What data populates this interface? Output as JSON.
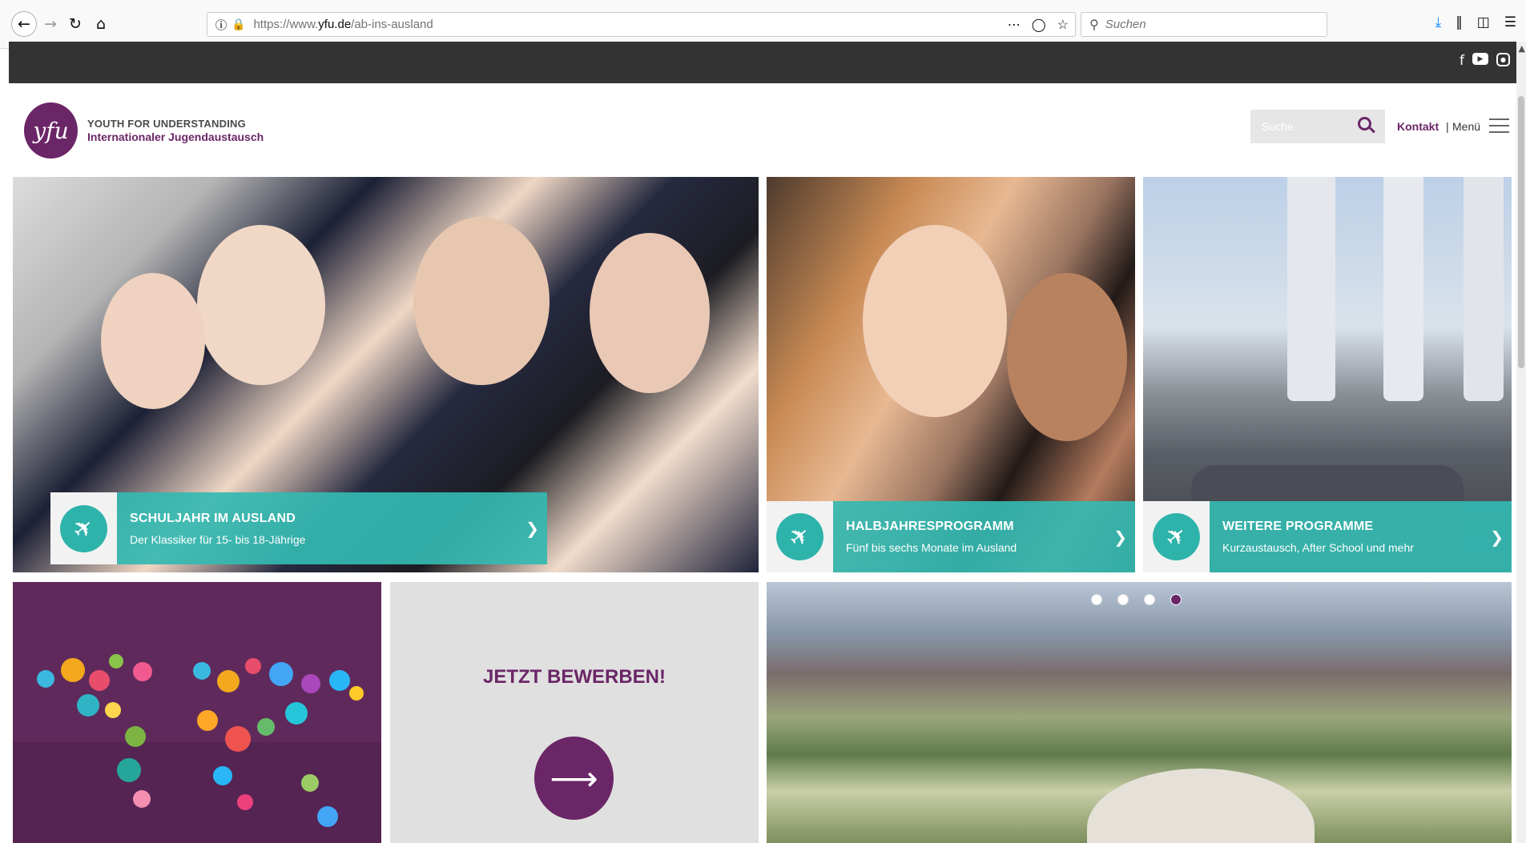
{
  "browser": {
    "url_prefix": "https://www.",
    "url_domain": "yfu.de",
    "url_path": "/ab-ins-ausland",
    "search_placeholder": "Suchen"
  },
  "site": {
    "logo_mark": "yfu",
    "logo_line1": "YOUTH FOR UNDERSTANDING",
    "logo_line2": "Internationaler Jugendaustausch",
    "search_placeholder": "Suche",
    "contact": "Kontakt",
    "menu_separator": "|",
    "menu": "Menü"
  },
  "tiles": [
    {
      "title": "SCHULJAHR IM AUSLAND",
      "subtitle": "Der Klassiker für 15- bis 18-Jährige"
    },
    {
      "title": "HALBJAHRESPROGRAMM",
      "subtitle": "Fünf bis sechs Monate im Ausland"
    },
    {
      "title": "WEITERE PROGRAMME",
      "subtitle": "Kurzaustausch, After School und mehr"
    }
  ],
  "apply": {
    "title": "JETZT BEWERBEN!"
  },
  "slider": {
    "dot_count": 4,
    "active_dot": 4
  },
  "colors": {
    "brand_purple": "#6b2667",
    "teal": "#34b8b1",
    "dark_strip": "#333333"
  }
}
